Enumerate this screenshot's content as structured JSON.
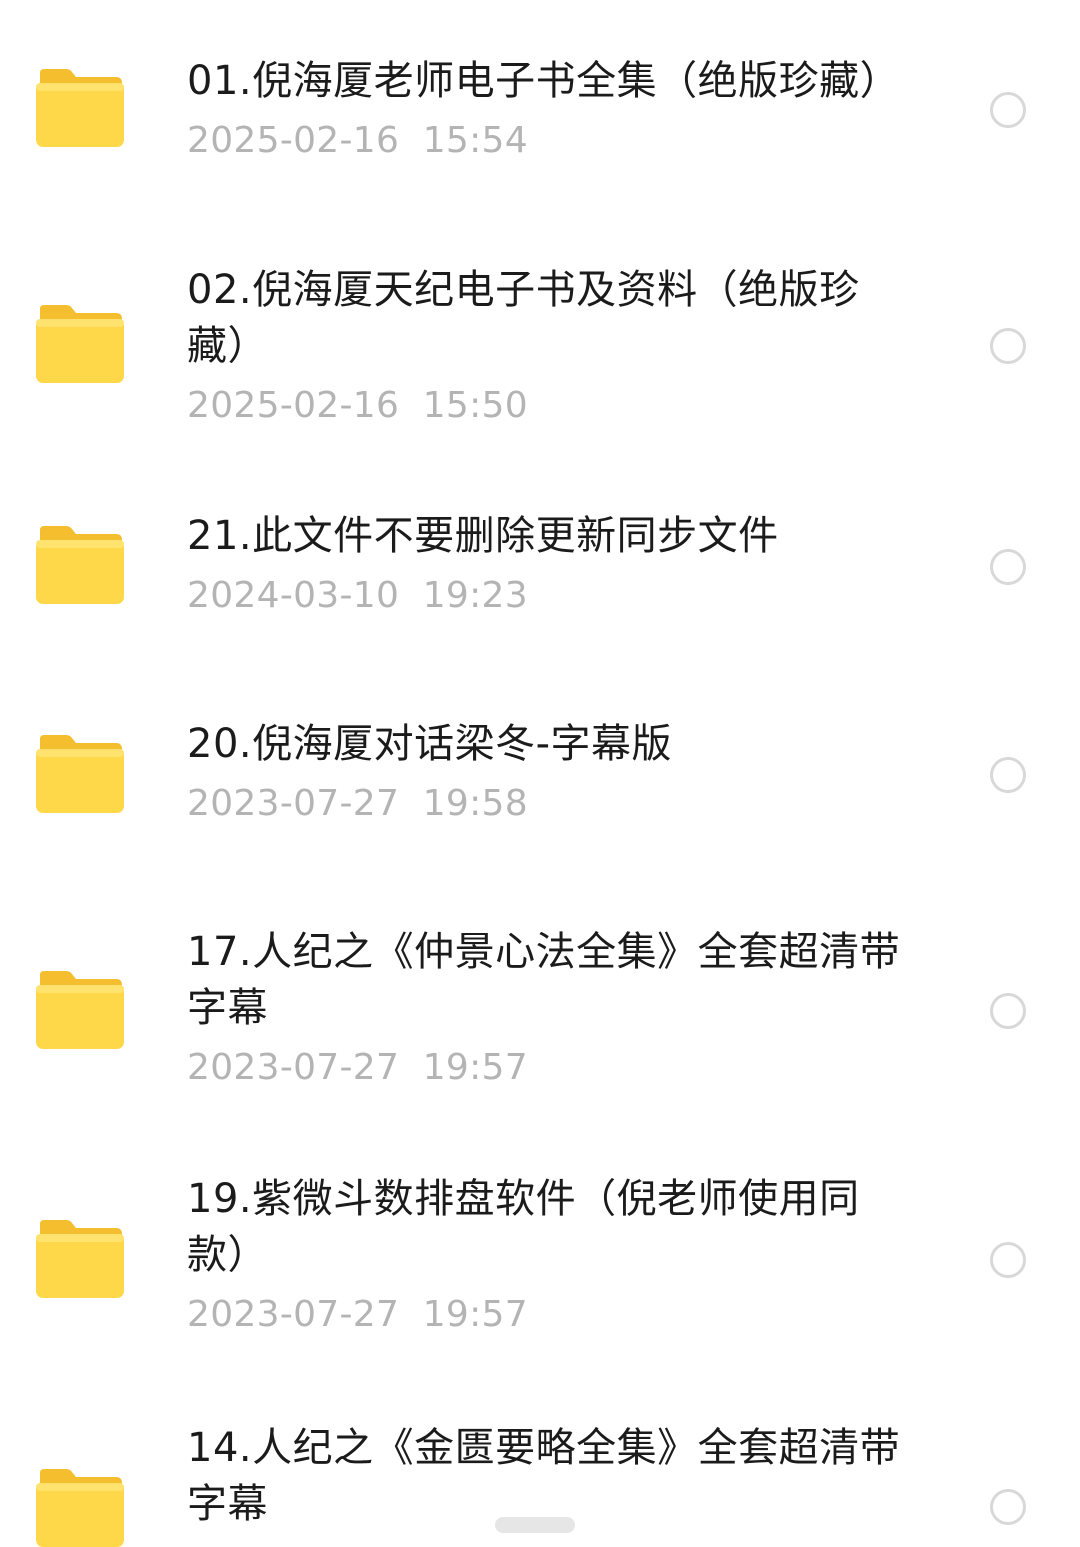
{
  "colors": {
    "folder_front": "#FFD84A",
    "folder_back": "#F5BE2E",
    "title_text": "#1B1B1B",
    "meta_text": "#B4B4B4",
    "radio_border": "#D8D8D8"
  },
  "files": [
    {
      "name": "01.倪海厦老师电子书全集（绝版珍藏）",
      "modified": "2025-02-16  15:54",
      "icon": "folder-icon",
      "selected": false
    },
    {
      "name": "02.倪海厦天纪电子书及资料（绝版珍藏）",
      "modified": "2025-02-16  15:50",
      "icon": "folder-icon",
      "selected": false
    },
    {
      "name": "21.此文件不要删除更新同步文件",
      "modified": "2024-03-10  19:23",
      "icon": "folder-icon",
      "selected": false
    },
    {
      "name": "20.倪海厦对话梁冬-字幕版",
      "modified": "2023-07-27  19:58",
      "icon": "folder-icon",
      "selected": false
    },
    {
      "name": "17.人纪之《仲景心法全集》全套超清带字幕",
      "modified": "2023-07-27  19:57",
      "icon": "folder-icon",
      "selected": false
    },
    {
      "name": "19.紫微斗数排盘软件（倪老师使用同款）",
      "modified": "2023-07-27  19:57",
      "icon": "folder-icon",
      "selected": false
    },
    {
      "name": "14.人纪之《金匮要略全集》全套超清带字幕",
      "modified": "",
      "icon": "folder-icon",
      "selected": false
    }
  ]
}
